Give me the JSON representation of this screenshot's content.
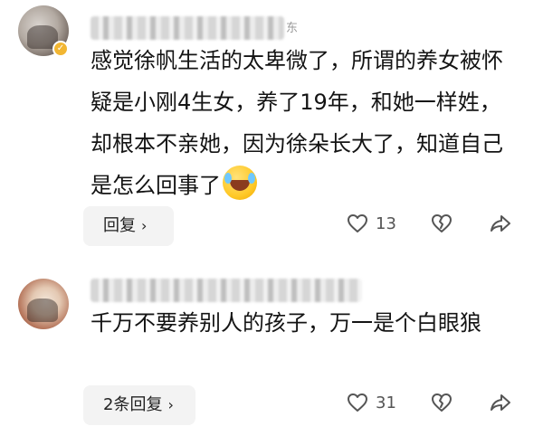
{
  "comments": [
    {
      "name_suffix": "东",
      "text": "感觉徐帆生活的太卑微了，所谓的养女被怀疑是小刚4生女，养了19年，和她一样姓，却根本不亲她，因为徐朵长大了，知道自己是怎么回事了",
      "emoji": "laugh-cry-emoji",
      "reply_label": "回复",
      "like_count": "13"
    },
    {
      "name_suffix": "",
      "text": "千万不要养别人的孩子，万一是个白眼狼",
      "reply_label": "2条回复",
      "like_count": "31"
    }
  ],
  "icons": {
    "like": "heart-outline-icon",
    "dislike": "broken-heart-icon",
    "share": "share-arrow-icon",
    "chevron": "chevron-right-icon"
  },
  "colors": {
    "text": "#141414",
    "button_bg": "#f3f3f3",
    "icon": "#555555",
    "badge": "#f2b632"
  }
}
